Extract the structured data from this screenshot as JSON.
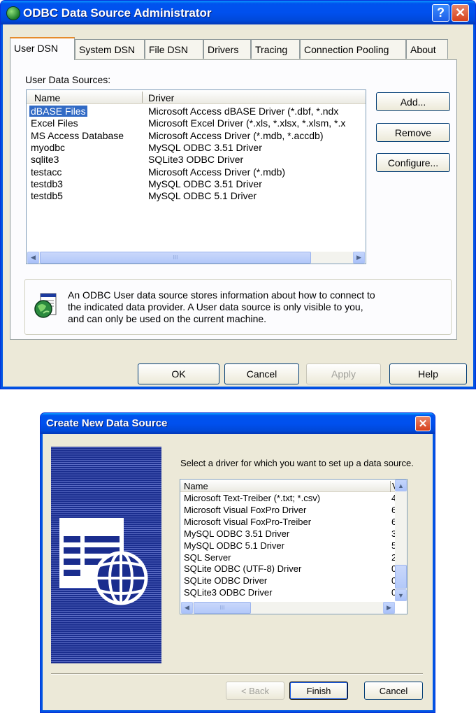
{
  "odbc": {
    "title": "ODBC Data Source Administrator",
    "help_glyph": "?",
    "close_glyph": "✕",
    "tabs": [
      "User DSN",
      "System DSN",
      "File DSN",
      "Drivers",
      "Tracing",
      "Connection Pooling",
      "About"
    ],
    "list_label": "User Data Sources:",
    "columns": [
      "Name",
      "Driver"
    ],
    "rows": [
      {
        "name": "dBASE Files",
        "driver": "Microsoft Access dBASE Driver (*.dbf, *.ndx"
      },
      {
        "name": "Excel Files",
        "driver": "Microsoft Excel Driver (*.xls, *.xlsx, *.xlsm, *.x"
      },
      {
        "name": "MS Access Database",
        "driver": "Microsoft Access Driver (*.mdb, *.accdb)"
      },
      {
        "name": "myodbc",
        "driver": "MySQL ODBC 3.51 Driver"
      },
      {
        "name": "sqlite3",
        "driver": "SQLite3 ODBC Driver"
      },
      {
        "name": "testacc",
        "driver": "Microsoft Access Driver (*.mdb)"
      },
      {
        "name": "testdb3",
        "driver": "MySQL ODBC 3.51 Driver"
      },
      {
        "name": "testdb5",
        "driver": "MySQL ODBC 5.1 Driver"
      }
    ],
    "selected_index": 0,
    "side_buttons": {
      "add": "Add...",
      "remove": "Remove",
      "configure": "Configure..."
    },
    "info_text": [
      "An ODBC User data source stores information about how to connect to",
      "the indicated data provider.   A User data source is only visible to you,",
      "and can only be used on the current machine."
    ],
    "bottom_buttons": {
      "ok": "OK",
      "cancel": "Cancel",
      "apply": "Apply",
      "help": "Help"
    },
    "scroll_thumb_glyph": "III"
  },
  "create": {
    "title": "Create New Data Source",
    "close_glyph": "✕",
    "instruction": "Select a driver for which you want to set up a data source.",
    "columns": [
      "Name",
      "V"
    ],
    "drivers": [
      {
        "name": "Microsoft Text-Treiber (*.txt; *.csv)",
        "v": "4"
      },
      {
        "name": "Microsoft Visual FoxPro Driver",
        "v": "6"
      },
      {
        "name": "Microsoft Visual FoxPro-Treiber",
        "v": "6"
      },
      {
        "name": "MySQL ODBC 3.51 Driver",
        "v": "3"
      },
      {
        "name": "MySQL ODBC 5.1 Driver",
        "v": "5"
      },
      {
        "name": "SQL Server",
        "v": "2"
      },
      {
        "name": "SQLite ODBC (UTF-8) Driver",
        "v": "0"
      },
      {
        "name": "SQLite ODBC Driver",
        "v": "0"
      },
      {
        "name": "SQLite3 ODBC Driver",
        "v": "0"
      }
    ],
    "buttons": {
      "back": "< Back",
      "finish": "Finish",
      "cancel": "Cancel"
    },
    "scroll_thumb_glyph": "III"
  },
  "colors": {
    "titlebar": "#0054e3",
    "selection": "#316ac5",
    "face": "#ece9d8",
    "wizard_panel": "#1a2d8e"
  }
}
